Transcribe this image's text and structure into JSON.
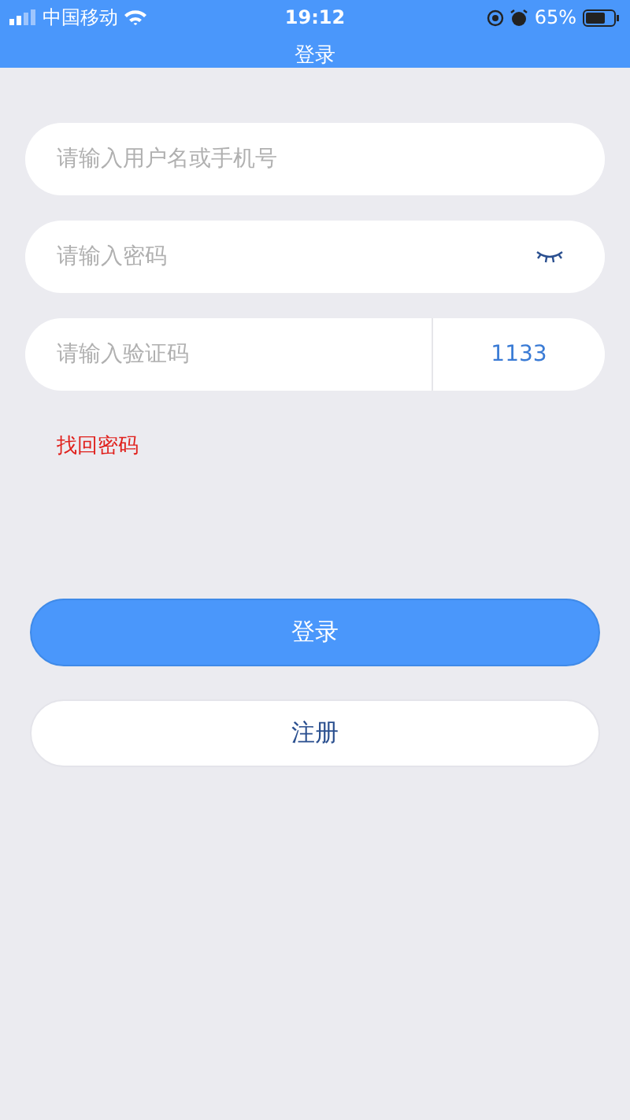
{
  "status_bar": {
    "carrier": "中国移动",
    "time": "19:12",
    "battery": "65%"
  },
  "nav": {
    "title": "登录"
  },
  "fields": [
    {
      "kind": "text",
      "placeholder": "请输入用户名或手机号"
    },
    {
      "kind": "password",
      "placeholder": "请输入密码"
    },
    {
      "kind": "captcha",
      "placeholder": "请输入验证码",
      "code": "1133"
    }
  ],
  "forgot_link": "找回密码",
  "buttons": [
    {
      "kind": "primary",
      "label": "登录"
    },
    {
      "kind": "secondary",
      "label": "注册"
    }
  ]
}
